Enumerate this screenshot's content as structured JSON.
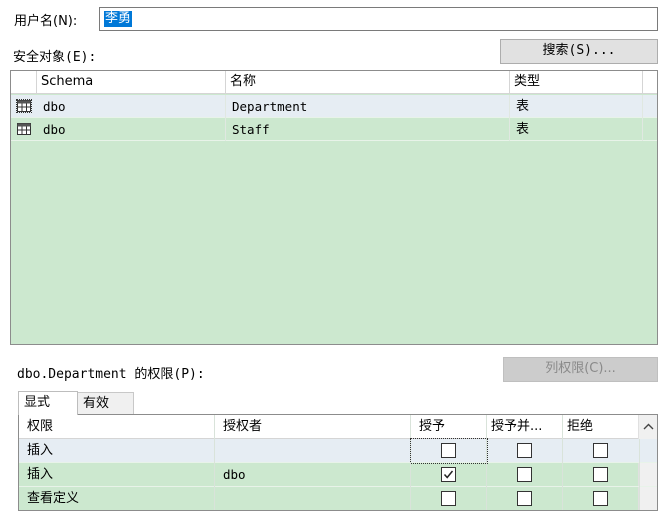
{
  "user": {
    "label": "用户名(N):",
    "value": "李勇"
  },
  "securables": {
    "label": "安全对象(E):",
    "search_button": "搜索(S)...",
    "columns": [
      "Schema",
      "名称",
      "类型"
    ],
    "rows": [
      {
        "schema": "dbo",
        "name": "Department",
        "type": "表",
        "icon": "table-icon"
      },
      {
        "schema": "dbo",
        "name": "Staff",
        "type": "表",
        "icon": "table-icon"
      }
    ]
  },
  "permissions": {
    "label": "dbo.Department 的权限(P):",
    "column_perm_button": "列权限(C)...",
    "tabs": [
      "显式",
      "有效"
    ],
    "columns": [
      "权限",
      "授权者",
      "授予",
      "授予并...",
      "拒绝"
    ],
    "rows": [
      {
        "permission": "插入",
        "grantor": "",
        "grant": false,
        "with_grant": false,
        "deny": false
      },
      {
        "permission": "插入",
        "grantor": "dbo",
        "grant": true,
        "with_grant": false,
        "deny": false
      },
      {
        "permission": "查看定义",
        "grantor": "",
        "grant": false,
        "with_grant": false,
        "deny": false
      }
    ]
  },
  "colors": {
    "grid_background": "#cce8cf",
    "selection": "#0078d7"
  }
}
